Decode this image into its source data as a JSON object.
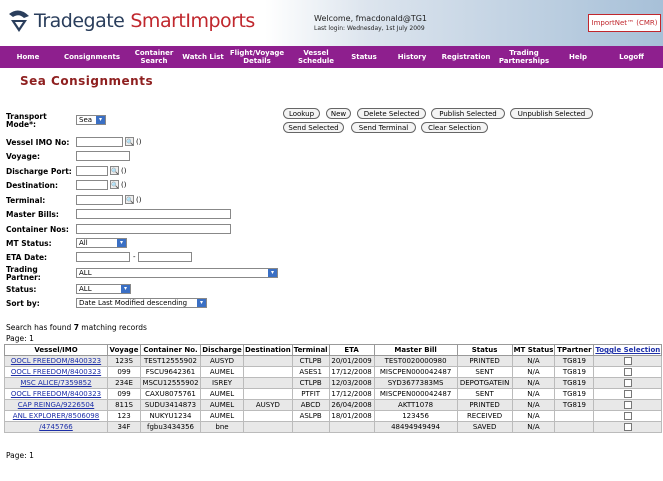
{
  "header": {
    "logo_text": "Tradegate",
    "logo_product": "SmartImports",
    "welcome": "Welcome, fmacdonald@TG1",
    "last_login": "Last login: Wednesday, 1st July 2009",
    "importnet_label": "ImportNet™ (CMR)"
  },
  "nav": {
    "items": [
      {
        "label": "Home"
      },
      {
        "label": "Consignments"
      },
      {
        "label": "Container Search"
      },
      {
        "label": "Watch List"
      },
      {
        "label": "Flight/Voyage Details"
      },
      {
        "label": "Vessel Schedule"
      },
      {
        "label": "Status"
      },
      {
        "label": "History"
      },
      {
        "label": "Registration"
      },
      {
        "label": "Trading Partnerships"
      },
      {
        "label": "Help"
      },
      {
        "label": "Logoff"
      }
    ]
  },
  "page": {
    "title": "Sea Consignments"
  },
  "form": {
    "transport_mode_label": "Transport Mode*:",
    "transport_mode_value": "Sea",
    "vessel_imo_label": "Vessel IMO No:",
    "voyage_label": "Voyage:",
    "discharge_port_label": "Discharge Port:",
    "destination_label": "Destination:",
    "terminal_label": "Terminal:",
    "master_bills_label": "Master Bills:",
    "container_nos_label": "Container Nos:",
    "mt_status_label": "MT Status:",
    "mt_status_value": "All",
    "eta_date_label": "ETA Date:",
    "eta_sep": "-",
    "trading_partner_label": "Trading Partner:",
    "trading_partner_value": "ALL",
    "status_label": "Status:",
    "status_value": "ALL",
    "sort_by_label": "Sort by:",
    "sort_by_value": "Date Last Modified descending",
    "paren": "()"
  },
  "actions": {
    "lookup": "Lookup",
    "new": "New",
    "delete_selected": "Delete Selected",
    "publish_selected": "Publish Selected",
    "unpublish_selected": "Unpublish Selected",
    "send_selected": "Send Selected",
    "send_terminal": "Send Terminal",
    "clear_selection": "Clear Selection"
  },
  "results": {
    "summary_pre": "Search has found ",
    "count": "7",
    "summary_post": " matching records",
    "page_top": "Page: 1",
    "page_bottom": "Page: 1"
  },
  "table": {
    "headers": [
      "Vessel/IMO",
      "Voyage",
      "Container No.",
      "Discharge",
      "Destination",
      "Terminal",
      "ETA",
      "Master Bill",
      "Status",
      "MT Status",
      "TPartner",
      "Toggle Selection"
    ],
    "rows": [
      [
        "OOCL FREEDOM/8400323",
        "123S",
        "TEST12555902",
        "AUSYD",
        "",
        "CTLPB",
        "20/01/2009",
        "TEST0020000980",
        "PRINTED",
        "N/A",
        "TG819"
      ],
      [
        "OOCL FREEDOM/8400323",
        "099",
        "FSCU9642361",
        "AUMEL",
        "",
        "ASES1",
        "17/12/2008",
        "MISCPEN000042487",
        "SENT",
        "N/A",
        "TG819"
      ],
      [
        "MSC ALICE/7359852",
        "234E",
        "MSCU12555902",
        "ISREY",
        "",
        "CTLPB",
        "12/03/2008",
        "SYD3677383MS",
        "DEPOTGATEIN",
        "N/A",
        "TG819"
      ],
      [
        "OOCL FREEDOM/8400323",
        "099",
        "CAXU8075761",
        "AUMEL",
        "",
        "PTFIT",
        "17/12/2008",
        "MISCPEN000042487",
        "SENT",
        "N/A",
        "TG819"
      ],
      [
        "CAP REINGA/9226504",
        "811S",
        "SUDU3414873",
        "AUMEL",
        "AUSYD",
        "ABCD",
        "26/04/2008",
        "AKTT1078",
        "PRINTED",
        "N/A",
        "TG819"
      ],
      [
        "ANL EXPLORER/8506098",
        "123",
        "NUKYU1234",
        "AUMEL",
        "",
        "ASLPB",
        "18/01/2008",
        "123456",
        "RECEIVED",
        "N/A",
        ""
      ],
      [
        "/4745766",
        "34F",
        "fgbu3434356",
        "bne",
        "",
        "",
        "",
        "48494949494",
        "SAVED",
        "N/A",
        ""
      ]
    ]
  },
  "colors": {
    "nav_bg": "#8e1f8e",
    "title": "#8e1f1f",
    "link": "#1d2fa8"
  }
}
